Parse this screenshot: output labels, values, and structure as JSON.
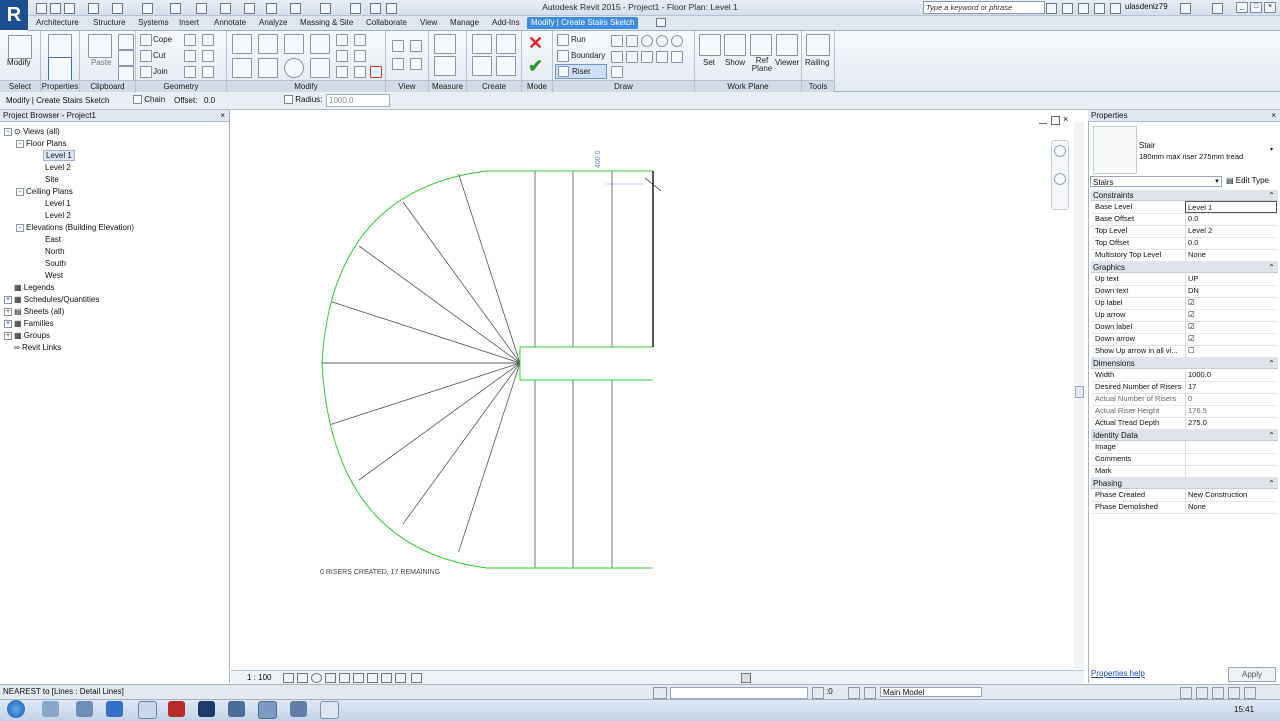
{
  "titlebar": {
    "logo": "R",
    "app_title": "Autodesk Revit 2015 -    Project1 - Floor Plan: Level 1",
    "search_placeholder": "Type a keyword or phrase",
    "user": "ulasdeniz79"
  },
  "tabs": [
    "Architecture",
    "Structure",
    "Systems",
    "Insert",
    "Annotate",
    "Analyze",
    "Massing & Site",
    "Collaborate",
    "View",
    "Manage",
    "Add-Ins",
    "Modify | Create Stairs Sketch"
  ],
  "ribbon": {
    "modify_label": "Modify",
    "properties_label": "Properties",
    "paste_label": "Paste",
    "cope_label": "Cope",
    "cut_label": "Cut",
    "join_label": "Join",
    "draw_run": "Run",
    "draw_boundary": "Boundary",
    "draw_riser": "Riser",
    "workplane_set": "Set",
    "workplane_show": "Show",
    "workplane_refplane": "Ref Plane",
    "workplane_viewer": "Viewer",
    "tools_railing": "Railing",
    "panels": {
      "select": "Select",
      "properties": "Properties",
      "clipboard": "Clipboard",
      "geometry": "Geometry",
      "modify": "Modify",
      "view": "View",
      "measure": "Measure",
      "create": "Create",
      "mode": "Mode",
      "draw": "Draw",
      "work_plane": "Work Plane",
      "tools": "Tools"
    }
  },
  "optionsbar": {
    "context": "Modify | Create Stairs Sketch",
    "chain_label": "Chain",
    "offset_label": "Offset:",
    "offset_value": "0.0",
    "radius_label": "Radius:",
    "radius_value": "1000.0"
  },
  "project_browser": {
    "title": "Project Browser - Project1",
    "views_all": "Views (all)",
    "floor_plans": "Floor Plans",
    "fp_level1": "Level 1",
    "fp_level2": "Level 2",
    "fp_site": "Site",
    "ceiling_plans": "Ceiling Plans",
    "cp_level1": "Level 1",
    "cp_level2": "Level 2",
    "elevations": "Elevations (Building Elevation)",
    "el_east": "East",
    "el_north": "North",
    "el_south": "South",
    "el_west": "West",
    "legends": "Legends",
    "schedules": "Schedules/Quantities",
    "sheets": "Sheets (all)",
    "families": "Families",
    "groups": "Groups",
    "revit_links": "Revit Links"
  },
  "canvas": {
    "temp_dimension": "400.0",
    "riser_message": "0 RISERS CREATED, 17 REMAINING",
    "scale": "1 : 100",
    "riser_count": 17,
    "created_risers": 0
  },
  "properties": {
    "title": "Properties",
    "family": "Stair",
    "type_name": "180mm max riser 275mm tread",
    "selector": "Stairs",
    "edit_type": "Edit Type",
    "groups": {
      "constraints": "Constraints",
      "graphics": "Graphics",
      "dimensions": "Dimensions",
      "identity": "Identity Data",
      "phasing": "Phasing"
    },
    "constraints": [
      {
        "k": "Base Level",
        "v": "Level 1"
      },
      {
        "k": "Base Offset",
        "v": "0.0"
      },
      {
        "k": "Top Level",
        "v": "Level 2"
      },
      {
        "k": "Top Offset",
        "v": "0.0"
      },
      {
        "k": "Multistory Top Level",
        "v": "None"
      }
    ],
    "graphics": [
      {
        "k": "Up text",
        "v": "UP"
      },
      {
        "k": "Down text",
        "v": "DN"
      },
      {
        "k": "Up label",
        "v": "☑"
      },
      {
        "k": "Up arrow",
        "v": "☑"
      },
      {
        "k": "Down label",
        "v": "☑"
      },
      {
        "k": "Down arrow",
        "v": "☑"
      },
      {
        "k": "Show Up arrow in all vi...",
        "v": "☐"
      }
    ],
    "dimensions": [
      {
        "k": "Width",
        "v": "1000.0"
      },
      {
        "k": "Desired Number of Risers",
        "v": "17"
      },
      {
        "k": "Actual Number of Risers",
        "v": "0"
      },
      {
        "k": "Actual Riser Height",
        "v": "176.5"
      },
      {
        "k": "Actual Tread Depth",
        "v": "275.0"
      }
    ],
    "identity": [
      {
        "k": "Image",
        "v": ""
      },
      {
        "k": "Comments",
        "v": ""
      },
      {
        "k": "Mark",
        "v": ""
      }
    ],
    "phasing": [
      {
        "k": "Phase Created",
        "v": "New Construction"
      },
      {
        "k": "Phase Demolished",
        "v": "None"
      }
    ],
    "help_link": "Properties help",
    "apply": "Apply"
  },
  "statusbar": {
    "message": "NEAREST  to [Lines : Detail Lines]",
    "zero": ":0",
    "model": "Main Model"
  },
  "taskbar": {
    "time": "15:41"
  },
  "colors": {
    "accent": "#3d8ee0",
    "sketch_green": "#33cc33",
    "riser_gray": "#555555"
  }
}
